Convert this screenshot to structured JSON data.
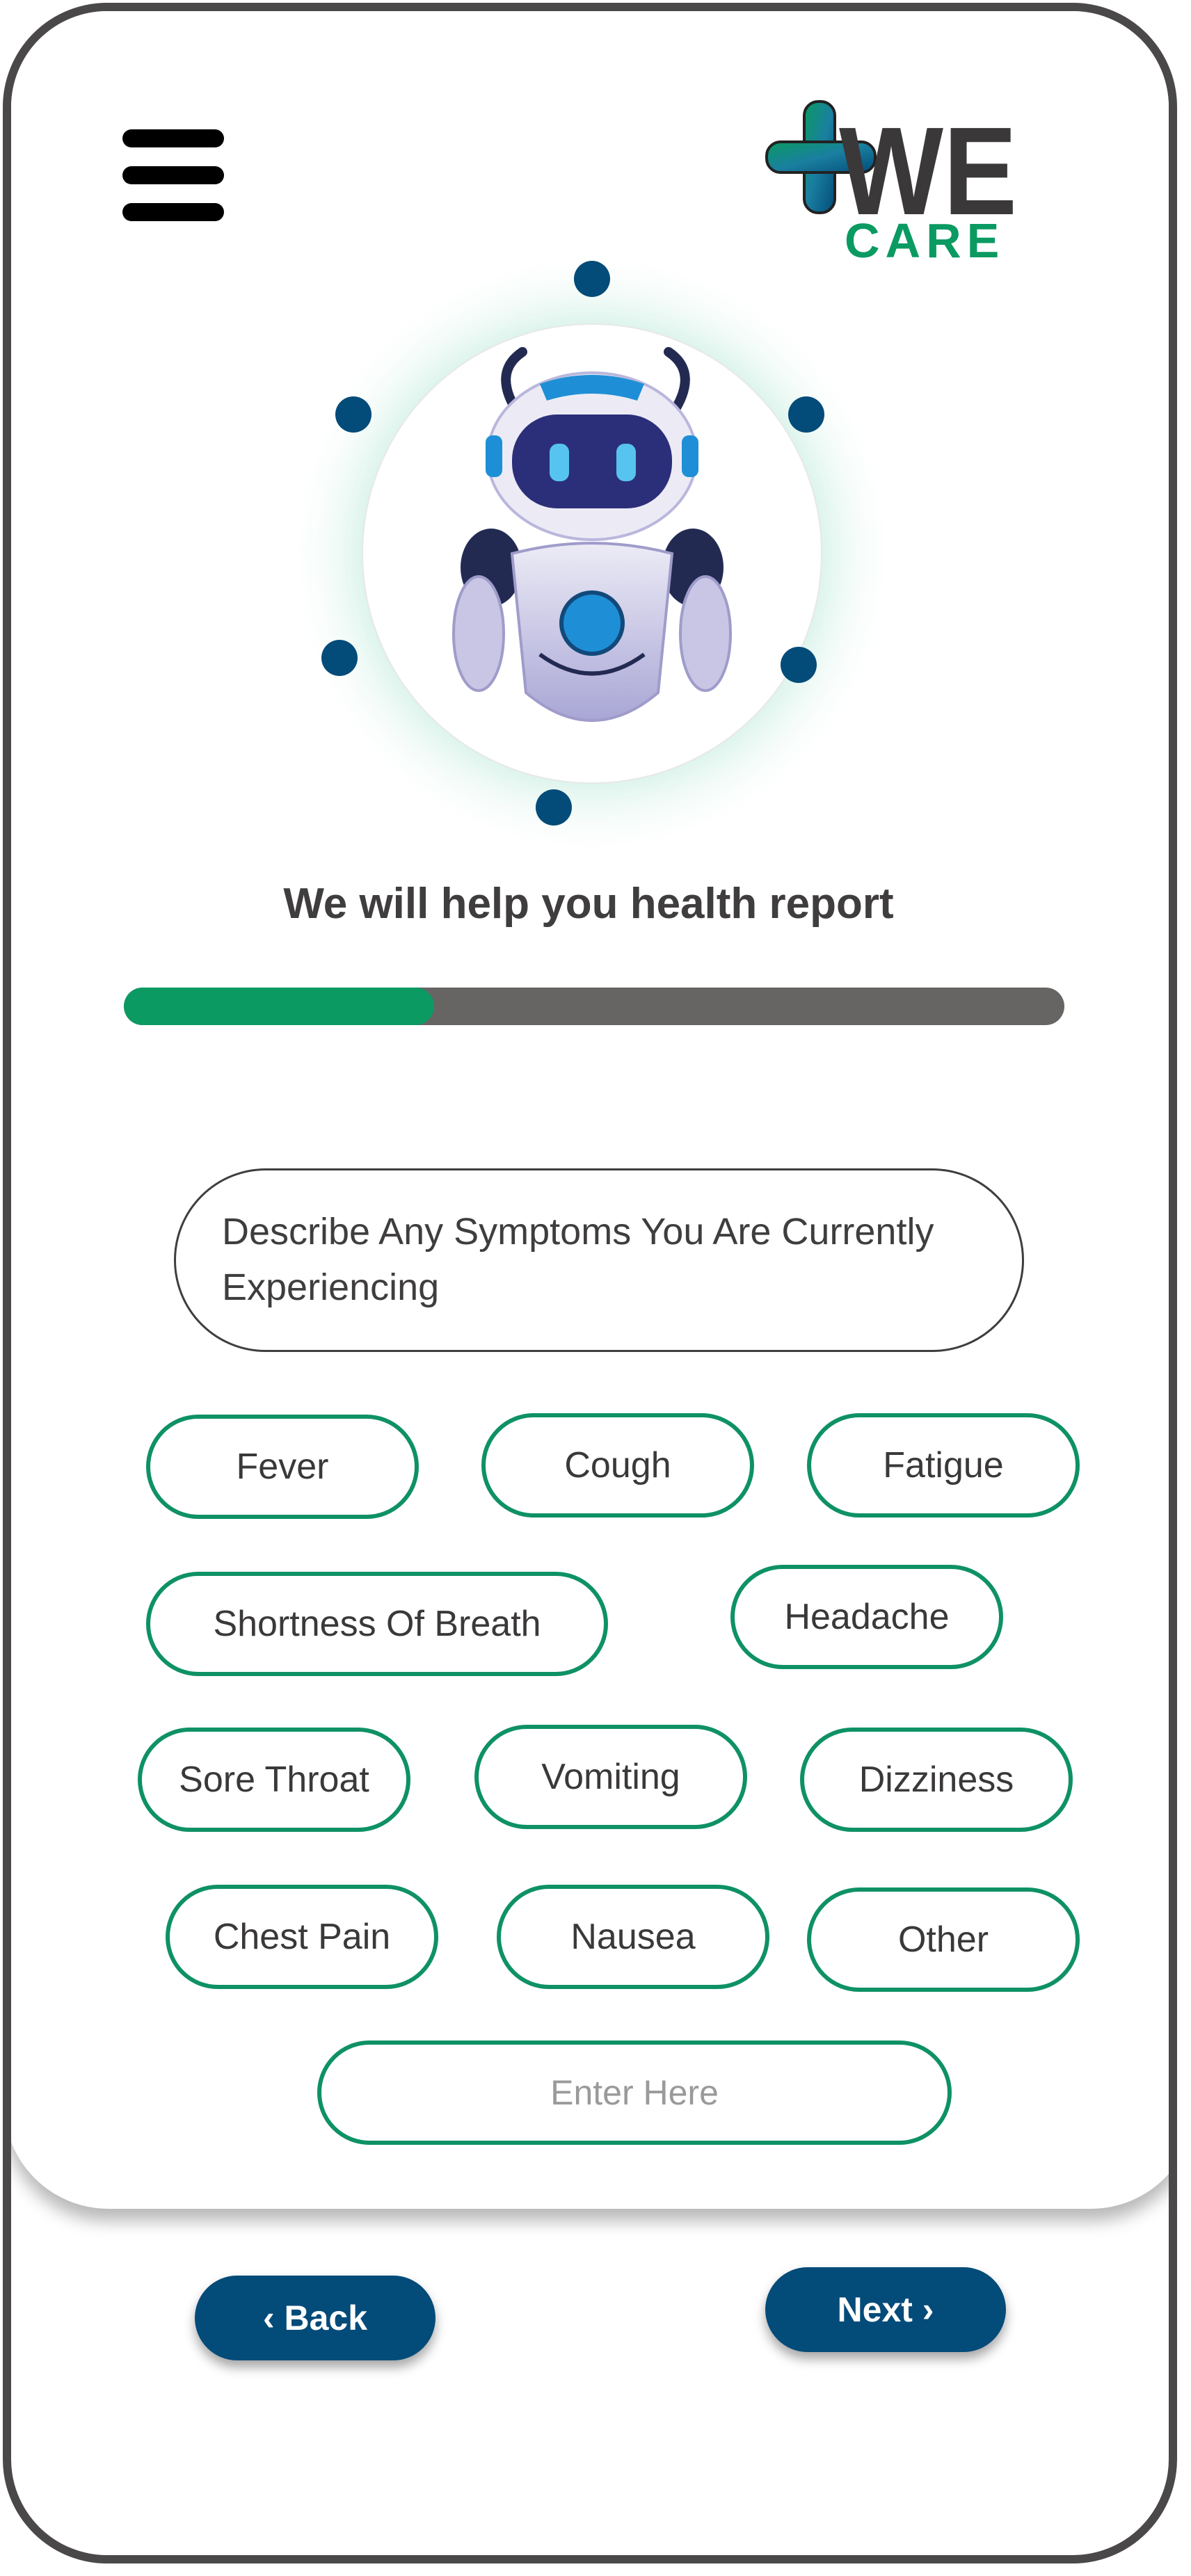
{
  "logo": {
    "word": "WE",
    "sub": "CARE"
  },
  "title": "We will help you health report",
  "progress": {
    "fraction": 0.33
  },
  "question": "Describe Any Symptoms You Are Currently Experiencing",
  "symptoms": [
    "Fever",
    "Cough",
    "Fatigue",
    "Shortness Of Breath",
    "Headache",
    "Sore Throat",
    "Vomiting",
    "Dizziness",
    "Chest Pain",
    "Nausea",
    "Other"
  ],
  "input": {
    "placeholder": "Enter Here",
    "value": ""
  },
  "nav": {
    "back": "‹ Back",
    "next": "Next ›"
  },
  "colors": {
    "accent_green": "#0a9a62",
    "navy": "#034b79",
    "frame": "#4a4849"
  }
}
